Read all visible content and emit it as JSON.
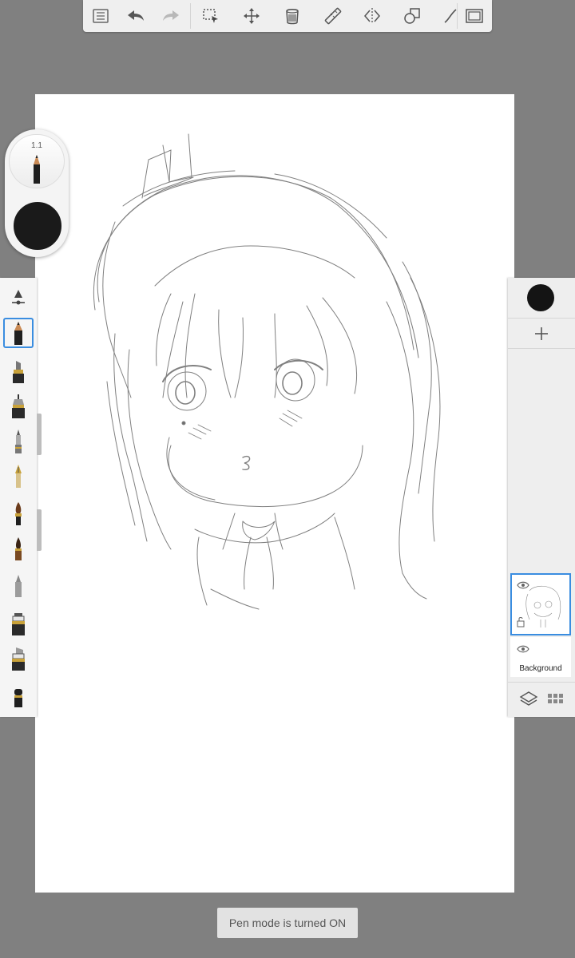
{
  "toolbar": {
    "icons": [
      "list-icon",
      "undo-icon",
      "redo-icon",
      "selection-icon",
      "transform-icon",
      "fill-icon",
      "ruler-icon",
      "symmetry-icon",
      "shapes-icon",
      "stroke-icon",
      "fullscreen-icon"
    ]
  },
  "brush_puck": {
    "size_label": "1.1",
    "color": "#1a1a1a"
  },
  "brushes": {
    "items": [
      "pencil",
      "chisel-marker",
      "fineliner",
      "ballpoint",
      "fountain-pen",
      "paint-brush",
      "ink-brush",
      "airbrush",
      "marker",
      "wide-marker",
      "eraser"
    ],
    "selected": "pencil"
  },
  "layers": {
    "current_color": "#141414",
    "items": [
      {
        "name": "",
        "selected": true,
        "visible": true
      },
      {
        "name": "Background",
        "selected": false,
        "visible": true
      }
    ]
  },
  "toast": {
    "message": "Pen mode is turned ON"
  }
}
